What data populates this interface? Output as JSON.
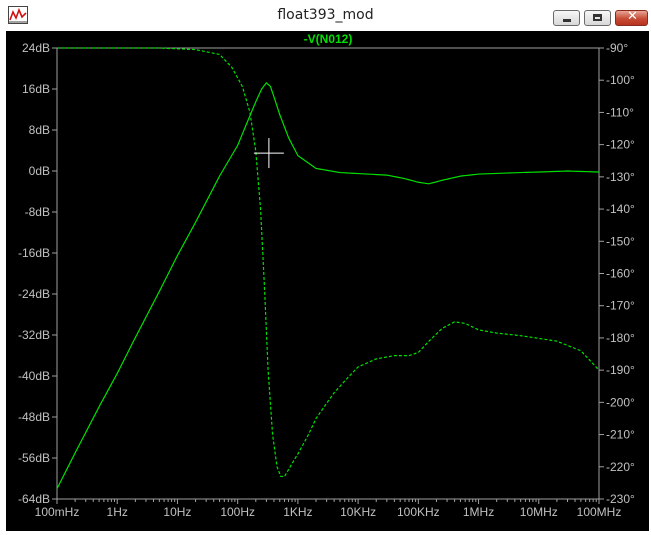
{
  "window": {
    "title": "float393_mod",
    "app_icon": "waveform-icon",
    "controls": {
      "minimize_icon": "minimize-icon",
      "maximize_icon": "maximize-icon",
      "close_icon": "close-icon",
      "close_label": "✕"
    }
  },
  "colors": {
    "background": "#000000",
    "trace": "#00e000",
    "axis": "#a0a0a0",
    "grid": "#808080",
    "cursor": "#ffffff"
  },
  "chart_data": {
    "type": "line",
    "title": "",
    "x_scale": "log",
    "x_unit": "Hz",
    "xlim": [
      0.1,
      100000000
    ],
    "x_ticks": [
      {
        "value": 0.1,
        "label": "100mHz"
      },
      {
        "value": 1,
        "label": "1Hz"
      },
      {
        "value": 10,
        "label": "10Hz"
      },
      {
        "value": 100,
        "label": "100Hz"
      },
      {
        "value": 1000,
        "label": "1KHz"
      },
      {
        "value": 10000,
        "label": "10KHz"
      },
      {
        "value": 100000,
        "label": "100KHz"
      },
      {
        "value": 1000000,
        "label": "1MHz"
      },
      {
        "value": 10000000,
        "label": "10MHz"
      },
      {
        "value": 100000000,
        "label": "100MHz"
      }
    ],
    "y_left": {
      "unit": "dB",
      "ylim": [
        -64,
        24
      ],
      "ticks": [
        {
          "value": 24,
          "label": "24dB"
        },
        {
          "value": 16,
          "label": "16dB"
        },
        {
          "value": 8,
          "label": "8dB"
        },
        {
          "value": 0,
          "label": "0dB"
        },
        {
          "value": -8,
          "label": "-8dB"
        },
        {
          "value": -16,
          "label": "-16dB"
        },
        {
          "value": -24,
          "label": "-24dB"
        },
        {
          "value": -32,
          "label": "-32dB"
        },
        {
          "value": -40,
          "label": "-40dB"
        },
        {
          "value": -48,
          "label": "-48dB"
        },
        {
          "value": -56,
          "label": "-56dB"
        },
        {
          "value": -64,
          "label": "-64dB"
        }
      ]
    },
    "y_right": {
      "unit": "°",
      "ylim": [
        -230,
        -90
      ],
      "ticks": [
        {
          "value": -90,
          "label": "-90°"
        },
        {
          "value": -100,
          "label": "-100°"
        },
        {
          "value": -110,
          "label": "-110°"
        },
        {
          "value": -120,
          "label": "-120°"
        },
        {
          "value": -130,
          "label": "-130°"
        },
        {
          "value": -140,
          "label": "-140°"
        },
        {
          "value": -150,
          "label": "-150°"
        },
        {
          "value": -160,
          "label": "-160°"
        },
        {
          "value": -170,
          "label": "-170°"
        },
        {
          "value": -180,
          "label": "-180°"
        },
        {
          "value": -190,
          "label": "-190°"
        },
        {
          "value": -200,
          "label": "-200°"
        },
        {
          "value": -210,
          "label": "-210°"
        },
        {
          "value": -220,
          "label": "-220°"
        },
        {
          "value": -230,
          "label": "-230°"
        }
      ]
    },
    "grid": false,
    "series": [
      {
        "name": "-V(N012)",
        "quantity": "magnitude",
        "axis": "left",
        "style": "solid",
        "points": [
          [
            0.1,
            -62
          ],
          [
            0.2,
            -55
          ],
          [
            0.5,
            -46
          ],
          [
            1,
            -39.5
          ],
          [
            2,
            -32.5
          ],
          [
            5,
            -23.5
          ],
          [
            10,
            -16.5
          ],
          [
            20,
            -10
          ],
          [
            50,
            -1
          ],
          [
            100,
            5
          ],
          [
            150,
            10
          ],
          [
            200,
            13.5
          ],
          [
            250,
            16
          ],
          [
            300,
            17.2
          ],
          [
            350,
            16.5
          ],
          [
            400,
            14.5
          ],
          [
            500,
            11
          ],
          [
            700,
            6.5
          ],
          [
            1000,
            3
          ],
          [
            2000,
            0.5
          ],
          [
            5000,
            -0.3
          ],
          [
            10000,
            -0.5
          ],
          [
            30000,
            -0.8
          ],
          [
            60000,
            -1.5
          ],
          [
            100000,
            -2.2
          ],
          [
            150000,
            -2.5
          ],
          [
            250000,
            -1.8
          ],
          [
            500000,
            -1
          ],
          [
            1000000,
            -0.6
          ],
          [
            5000000,
            -0.3
          ],
          [
            10000000,
            -0.2
          ],
          [
            30000000,
            0
          ],
          [
            100000000,
            -0.2
          ]
        ]
      },
      {
        "name": "-V(N012)",
        "quantity": "phase",
        "axis": "right",
        "style": "dashed",
        "points": [
          [
            0.1,
            -90
          ],
          [
            1,
            -90
          ],
          [
            5,
            -90
          ],
          [
            20,
            -90.5
          ],
          [
            50,
            -92
          ],
          [
            80,
            -96
          ],
          [
            120,
            -102
          ],
          [
            160,
            -110
          ],
          [
            200,
            -122
          ],
          [
            240,
            -140
          ],
          [
            280,
            -165
          ],
          [
            320,
            -190
          ],
          [
            380,
            -210
          ],
          [
            450,
            -220
          ],
          [
            520,
            -223
          ],
          [
            600,
            -223
          ],
          [
            800,
            -219
          ],
          [
            1000,
            -216
          ],
          [
            1500,
            -210
          ],
          [
            2000,
            -205
          ],
          [
            4000,
            -197
          ],
          [
            7000,
            -192
          ],
          [
            10000,
            -189
          ],
          [
            20000,
            -186.5
          ],
          [
            40000,
            -185.5
          ],
          [
            70000,
            -185.5
          ],
          [
            100000,
            -184.5
          ],
          [
            150000,
            -181
          ],
          [
            250000,
            -177
          ],
          [
            400000,
            -175
          ],
          [
            600000,
            -175.5
          ],
          [
            1000000,
            -177.5
          ],
          [
            2000000,
            -178.5
          ],
          [
            5000000,
            -179.3
          ],
          [
            20000000,
            -181
          ],
          [
            50000000,
            -184
          ],
          [
            100000000,
            -190
          ]
        ]
      }
    ],
    "cursor": {
      "x": 330,
      "y_db": 3.5
    }
  }
}
